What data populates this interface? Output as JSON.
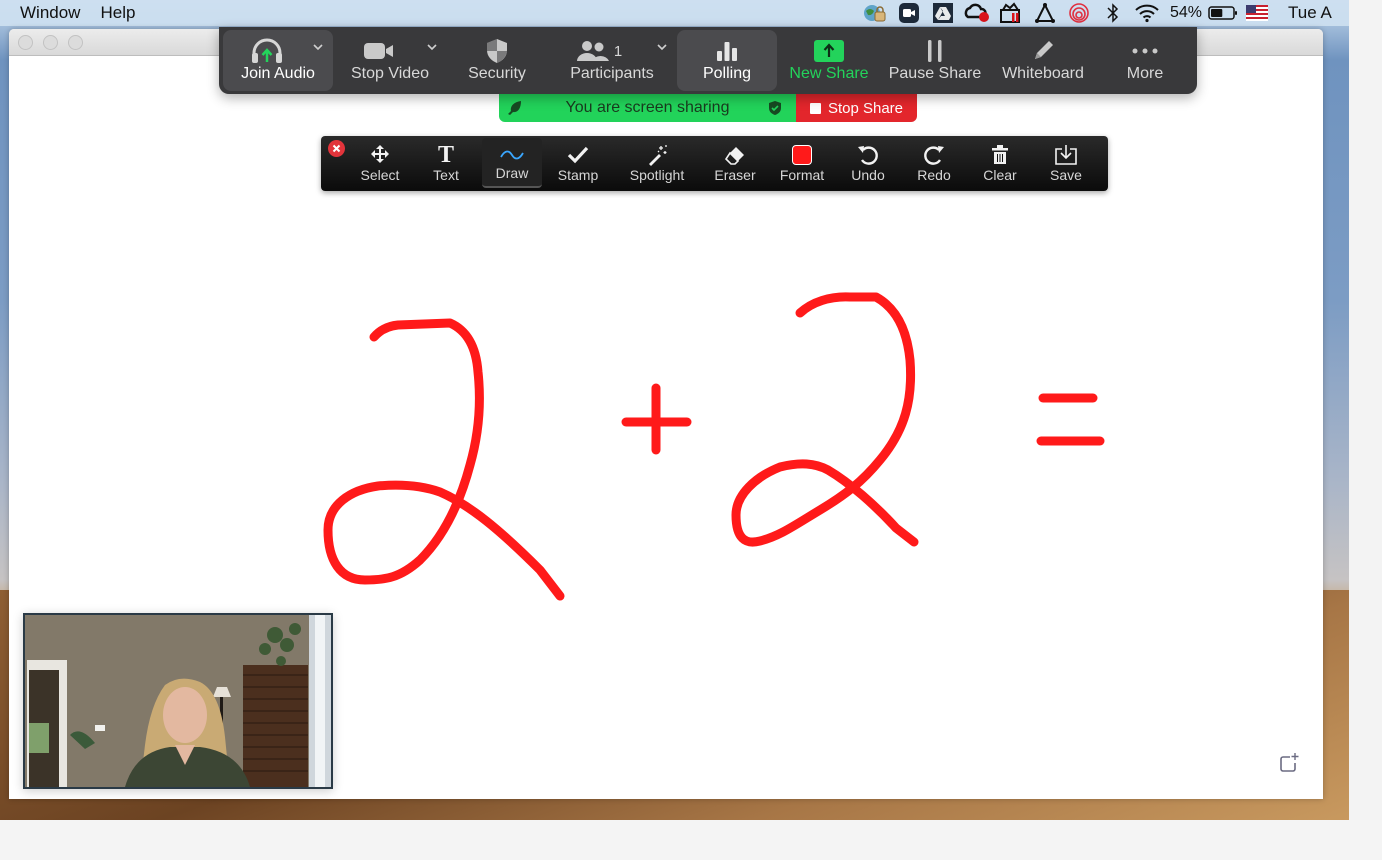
{
  "menubar": {
    "menus": [
      "Window",
      "Help"
    ],
    "status_icons": [
      "vpn-lock-icon",
      "zoom-app-icon",
      "google-drive-icon",
      "creative-cloud-recording-icon",
      "toolbox-icon",
      "triangle-app-icon",
      "rings-app-icon",
      "bluetooth-icon",
      "wifi-icon"
    ],
    "battery_percent": "54%",
    "battery_level": 0.54,
    "input_source": "us-flag-icon",
    "date_partial": "Tue A"
  },
  "meeting_toolbar": {
    "buttons": [
      {
        "id": "join-audio",
        "label": "Join Audio",
        "icon": "headphones-icon",
        "has_caret": true,
        "active": true
      },
      {
        "id": "stop-video",
        "label": "Stop Video",
        "icon": "video-camera-icon",
        "has_caret": true
      },
      {
        "id": "security",
        "label": "Security",
        "icon": "shield-icon"
      },
      {
        "id": "participants",
        "label": "Participants",
        "icon": "people-icon",
        "count": "1",
        "has_caret": true
      },
      {
        "id": "polling",
        "label": "Polling",
        "icon": "bar-chart-icon",
        "active": true
      },
      {
        "id": "new-share",
        "label": "New Share",
        "icon": "share-up-arrow-icon"
      },
      {
        "id": "pause-share",
        "label": "Pause Share",
        "icon": "pause-icon"
      },
      {
        "id": "whiteboard",
        "label": "Whiteboard",
        "icon": "pencil-icon"
      },
      {
        "id": "more",
        "label": "More",
        "icon": "more-dots-icon"
      }
    ]
  },
  "share_banner": {
    "message": "You are screen sharing",
    "stop_label": "Stop Share"
  },
  "annotation_toolbar": {
    "tools": [
      {
        "id": "select",
        "label": "Select",
        "icon": "move-arrows-icon"
      },
      {
        "id": "text",
        "label": "Text",
        "icon": "text-t-icon"
      },
      {
        "id": "draw",
        "label": "Draw",
        "icon": "squiggle-icon",
        "active": true
      },
      {
        "id": "stamp",
        "label": "Stamp",
        "icon": "checkmark-icon"
      },
      {
        "id": "spotlight",
        "label": "Spotlight",
        "icon": "magic-wand-icon"
      },
      {
        "id": "eraser",
        "label": "Eraser",
        "icon": "eraser-icon"
      },
      {
        "id": "format",
        "label": "Format",
        "icon": "color-swatch-icon"
      },
      {
        "id": "undo",
        "label": "Undo",
        "icon": "undo-icon"
      },
      {
        "id": "redo",
        "label": "Redo",
        "icon": "redo-icon"
      },
      {
        "id": "clear",
        "label": "Clear",
        "icon": "trash-icon"
      },
      {
        "id": "save",
        "label": "Save",
        "icon": "save-download-icon"
      }
    ],
    "format_color": "#ff1a1a"
  },
  "whiteboard": {
    "ink_color": "#ff1a1a",
    "content_description": "2 + 2 ="
  },
  "colors": {
    "share_green": "#22d35a",
    "stop_red": "#e3262c",
    "draw_accent": "#3aa7ff"
  }
}
